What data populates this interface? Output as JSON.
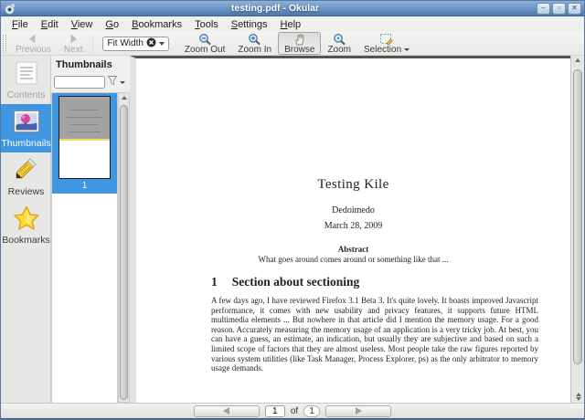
{
  "window": {
    "title": "testing.pdf - Okular"
  },
  "menu": {
    "items": [
      "File",
      "Edit",
      "View",
      "Go",
      "Bookmarks",
      "Tools",
      "Settings",
      "Help"
    ]
  },
  "toolbar": {
    "previous_label": "Previous",
    "next_label": "Next",
    "zoom_combo_value": "Fit Width",
    "zoom_out_label": "Zoom Out",
    "zoom_in_label": "Zoom In",
    "browse_label": "Browse",
    "zoom_label": "Zoom",
    "selection_label": "Selection"
  },
  "sidebar": {
    "items": [
      {
        "label": "Contents",
        "state": "disabled"
      },
      {
        "label": "Thumbnails",
        "state": "selected"
      },
      {
        "label": "Reviews",
        "state": "normal"
      },
      {
        "label": "Bookmarks",
        "state": "normal"
      }
    ]
  },
  "thumbnails_panel": {
    "header": "Thumbnails",
    "filter_placeholder": "",
    "page_number": "1"
  },
  "document": {
    "title": "Testing Kile",
    "author": "Dedoimedo",
    "date": "March 28, 2009",
    "abstract_heading": "Abstract",
    "abstract_text": "What goes around comes around or something like that ...",
    "section_number": "1",
    "section_title": "Section about sectioning",
    "body": "A few days ago, I have reviewed Firefox 3.1 Beta 3. It's quite lovely. It boasts improved Javascript performance, it comes with new usability and privacy features, it supports future HTML multimedia elements ... But nowhere in that article did I mention the memory usage. For a good reason. Accurately measuring the memory usage of an application is a very tricky job. At best, you can have a guess, an estimate, an indication, but usually they are subjective and based on such a limited scope of factors that they are almost useless. Most people take the raw figures reported by various system utilities (like Task Manager, Process Explorer, ps) as the only arbitrator to memory usage demands."
  },
  "pagebar": {
    "current_page": "1",
    "of_label": "of",
    "total_pages": "1"
  },
  "icons": {
    "okular-icon": "app-logo",
    "minimize-icon": "–",
    "maximize-icon": "▫",
    "close-icon": "✕",
    "previous-icon": "left-arrow",
    "next-icon": "right-arrow",
    "clear-icon": "black-circle-x",
    "combo-caret-icon": "caret-down",
    "zoom-out-icon": "magnifier-minus",
    "zoom-in-icon": "magnifier-plus",
    "browse-icon": "hand",
    "zoom-icon": "magnifier",
    "selection-icon": "dashed-box-pencil",
    "contents-icon": "text-lines-page",
    "thumbnails-icon": "picture",
    "reviews-icon": "pencil",
    "bookmarks-icon": "star",
    "filter-icon": "funnel",
    "scroll-up-icon": "triangle-up",
    "scroll-down-icon": "triangle-down",
    "page-prev-icon": "triangle-left",
    "page-next-icon": "triangle-right"
  },
  "colors": {
    "titlebar_top": "#8fafd8",
    "titlebar_bottom": "#4d77a9",
    "selection_blue": "#3f97e2",
    "viewport_marker_yellow": "#e6de66",
    "star_yellow": "#ffd93d",
    "toolbar_bg": "#efefed"
  }
}
